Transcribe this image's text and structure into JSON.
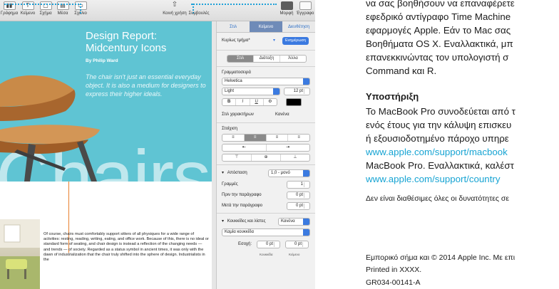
{
  "toolbar": {
    "left_items": [
      {
        "label": "Γράφημα",
        "icon": "chart-icon",
        "glyph": "▮▮"
      },
      {
        "label": "Κείμενο",
        "icon": "text-box-icon",
        "glyph": "T"
      },
      {
        "label": "Σχήμα",
        "icon": "shape-icon",
        "glyph": "▢"
      },
      {
        "label": "Μέσα",
        "icon": "media-icon",
        "glyph": "▤"
      },
      {
        "label": "Σχόλιο",
        "icon": "comment-icon",
        "glyph": "▭"
      }
    ],
    "share_label": "Κοινή χρήση",
    "share_glyph": "⇧",
    "tips_label": "Συμβουλές",
    "format_label": "Μορφή",
    "document_label": "Έγγραφο"
  },
  "document": {
    "title": "Design Report:\nMidcentury Icons",
    "author": "By Philip Ward",
    "quote": "The chair isn't just an essential everyday object. It is also a medium for designers to express their higher ideals.",
    "big_word": "Chairs",
    "body": "Of course, chairs must comfortably support sitters of all physiques for a wide range of activities: resting, reading, writing, eating, and office work. Because of this, there is no ideal or standard form of seating, and chair design is instead a reflection of the changing needs — and trends — of society. Regarded as a status symbol in ancient times, it was only with the dawn of industrialization that the chair truly shifted into the sphere of design. Industrialists in the"
  },
  "sidebar": {
    "tabs": [
      "Στιλ",
      "Κείμενο",
      "Διευθέτηση"
    ],
    "active_tab": 1,
    "paragraph_style": "Κυρίως τμήμα*",
    "update_button": "Ενημέρωση",
    "sub_tabs": [
      "Στιλ",
      "Διάταξη",
      "Άλλα"
    ],
    "font_header": "Γραμματοσειρά",
    "font_family": "Helvetica",
    "font_weight": "Light",
    "font_size": "12 pt",
    "char_style_label": "Στιλ χαρακτήρων",
    "char_style_value": "Κανένα",
    "align_header": "Στοίχιση",
    "spacing_label": "Απόσταση",
    "spacing_value": "1,0 - μονό",
    "lines_label": "Γραμμές",
    "lines_value": "1",
    "before_label": "Πριν την παράγραφο",
    "before_value": "0 pt",
    "after_label": "Μετά την παράγραφο",
    "after_value": "0 pt",
    "bullets_label": "Κουκκίδες και λίστες",
    "bullets_value": "Κανένα",
    "bullet_type": "Καμία κουκκίδα",
    "indent_label": "Εσοχή:",
    "indent_bullet_value": "0 pt",
    "indent_text_value": "0 pt",
    "indent_bullet_caption": "Κουκκίδα",
    "indent_text_caption": "Κείμενο"
  },
  "right_text": {
    "lines": [
      "να σας βοηθήσουν να επαναφέρετε",
      "εφεδρικό αντίγραφο Time Machine",
      "εφαρμογές Apple. Εάν το Mac σας",
      "Βοηθήματα OS X. Εναλλακτικά, μπ",
      "επανεκκινώντας τον υπολογιστή σ",
      "Command και R."
    ],
    "support_heading": "Υποστήριξη",
    "support_lines": [
      "Το MacBook Pro συνοδεύεται από τ",
      "ενός έτους για την κάλυψη επισκευ",
      "ή εξουσιοδοτημένο πάροχο υπηρε"
    ],
    "link1": "www.apple.com/support/macbook",
    "after_link": "MacBook Pro. Εναλλακτικά, καλέστ",
    "link2": "www.apple.com/support/country",
    "note": "Δεν είναι διαθέσιμες όλες οι δυνατότητες σε",
    "trademark": "Εμπορικό σήμα και © 2014 Apple Inc. Με επι",
    "printed": "Printed in XXXX.",
    "code": "GR034-00141-A"
  },
  "colors": {
    "hero": "#5fc4d3",
    "accent_blue": "#3b7ae0",
    "link": "#17a4d3",
    "callout_dots": "#1ea0d8",
    "rule_orange": "#e8812f"
  }
}
